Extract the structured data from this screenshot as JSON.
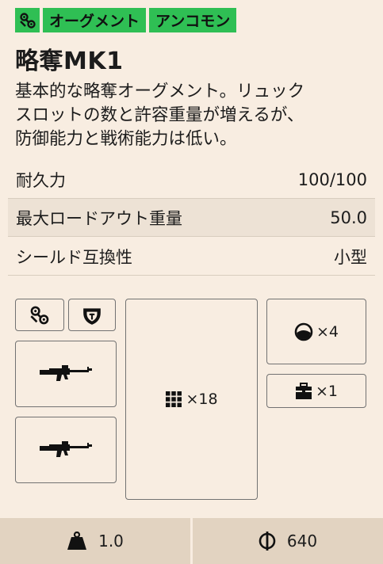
{
  "header": {
    "tags": [
      "オーグメント",
      "アンコモン"
    ],
    "tag_color": "#2fbf54",
    "title": "略奪MK1",
    "description_lines": [
      "基本的な略奪オーグメント。リュック",
      "スロットの数と許容重量が増えるが、",
      "防御能力と戦術能力は低い。"
    ]
  },
  "stats": [
    {
      "label": "耐久力",
      "value": "100/100"
    },
    {
      "label": "最大ロードアウト重量",
      "value": "50.0"
    },
    {
      "label": "シールド互換性",
      "value": "小型"
    }
  ],
  "slots": {
    "augment_icon": "augment-icon",
    "shield_icon": "shield-icon",
    "weapon_icon": "rifle-icon",
    "backpack_count": "×18",
    "quick_use_count": "×4",
    "safe_pocket_count": "×1"
  },
  "footer": {
    "weight": "1.0",
    "price": "640"
  }
}
